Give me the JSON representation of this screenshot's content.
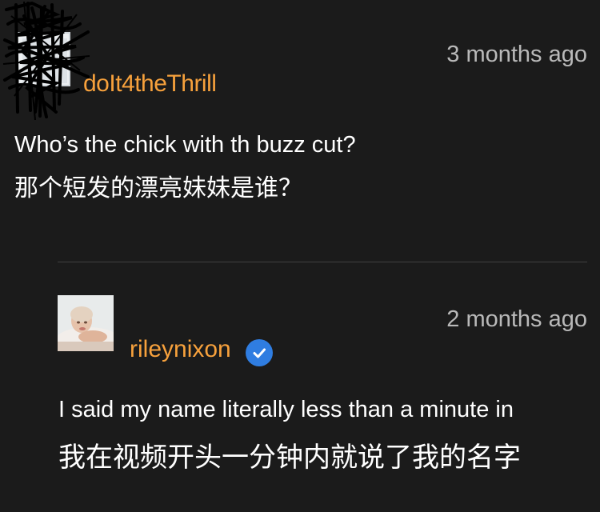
{
  "comment": {
    "username": "doIt4theThrill",
    "timestamp": "3 months ago",
    "text_en": "Who’s the chick with th buzz cut?",
    "text_zh": "那个短发的漂亮妹妹是谁？",
    "avatar_icon": "redacted-avatar-scribble"
  },
  "reply": {
    "username": "rileynixon",
    "verified": true,
    "verified_icon": "verified-badge-icon",
    "timestamp": "2 months ago",
    "text_en": "I said my name literally less than a minute in",
    "text_zh": "我在视频开头一分钟内就说了我的名字",
    "avatar_icon": "user-photo-avatar"
  },
  "colors": {
    "background": "#1b1b1b",
    "username": "#f7a13c",
    "timestamp": "#b9b9b9",
    "text": "#ffffff",
    "divider": "#3f3f3f",
    "verified": "#2f7de1"
  }
}
